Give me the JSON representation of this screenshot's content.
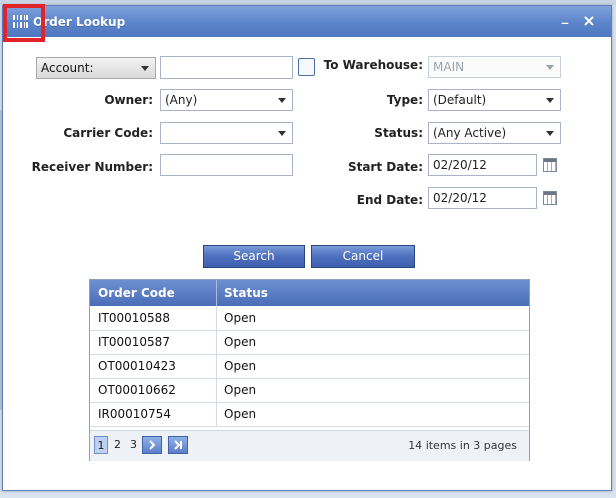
{
  "window": {
    "title": "Order Lookup",
    "minimize_label": "_",
    "close_label": "×"
  },
  "form": {
    "account_select": "Account:",
    "account_value": "",
    "owner_label": "Owner:",
    "owner_value": "(Any)",
    "carrier_label": "Carrier Code:",
    "carrier_value": "",
    "receiver_label": "Receiver Number:",
    "receiver_value": "",
    "to_warehouse_label": "To Warehouse:",
    "to_warehouse_value": "MAIN",
    "type_label": "Type:",
    "type_value": "(Default)",
    "status_label": "Status:",
    "status_value": "(Any Active)",
    "start_date_label": "Start Date:",
    "start_date_value": "02/20/12",
    "end_date_label": "End Date:",
    "end_date_value": "02/20/12"
  },
  "buttons": {
    "search": "Search",
    "cancel": "Cancel"
  },
  "grid": {
    "columns": [
      "Order Code",
      "Status"
    ],
    "rows": [
      [
        "IT00010588",
        "Open"
      ],
      [
        "IT00010587",
        "Open"
      ],
      [
        "OT00010423",
        "Open"
      ],
      [
        "OT00010662",
        "Open"
      ],
      [
        "IR00010754",
        "Open"
      ]
    ]
  },
  "pager": {
    "pages": [
      "1",
      "2",
      "3"
    ],
    "current_page": "1",
    "total_items": "14",
    "info_text": "items in 3 pages"
  },
  "colors": {
    "titlebar": "#5c84c9",
    "highlight": "#e0242a",
    "button": "#4d6fbe"
  },
  "icons": {
    "title": "order-lookup-icon",
    "next": "next-page-icon",
    "last": "last-page-icon",
    "calendar": "calendar-icon"
  }
}
